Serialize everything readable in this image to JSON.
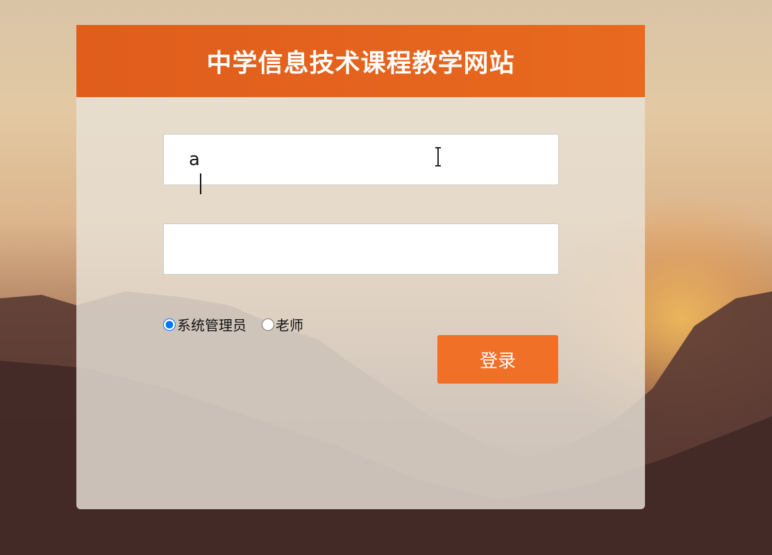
{
  "page": {
    "title": "中学信息技术课程教学网站"
  },
  "login_form": {
    "username_value": "a",
    "password_value": "",
    "roles": [
      {
        "label": "系统管理员",
        "value": "admin",
        "checked": true
      },
      {
        "label": "老师",
        "value": "teacher",
        "checked": false
      }
    ],
    "submit_label": "登录"
  },
  "colors": {
    "header": "#e4621e",
    "button": "#f07028",
    "panel": "#e8e2d7"
  },
  "icons": {
    "cursor": "text-cursor-ibeam-icon"
  }
}
